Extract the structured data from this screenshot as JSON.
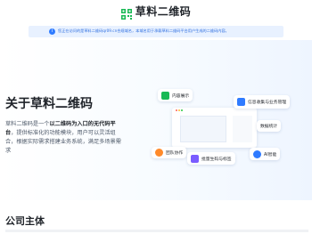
{
  "header": {
    "brand_text": "草料二维码",
    "logo_icon": "qr-logo-icon",
    "brand_color": "#19b955"
  },
  "notice": {
    "text": "您正在访问的是草料二维码qr09.cn合规域名，本域名用于承载草料二维码平台用户生成的二维码内容。",
    "accent": "#2f7bff"
  },
  "hero": {
    "title": "关于草料二维码",
    "desc_prefix": "草料二维码是一个",
    "desc_bold": "以二维码为入口的无代码平台",
    "desc_suffix": "，提供标准化的功能模块，用户可以灵活组合，根据实际需求搭建业务系统，满足多场景需求"
  },
  "diagram": {
    "features": [
      {
        "label": "内容展示",
        "icon": "content-icon",
        "color": "#19b955"
      },
      {
        "label": "信息收集与业务管理",
        "icon": "form-icon",
        "color": "#2f7bff"
      },
      {
        "label": "数据统计",
        "icon": "stats-icon",
        "color": "#2f7bff"
      },
      {
        "label": "团队协作",
        "icon": "team-icon",
        "color": "#ff8a2b"
      },
      {
        "label": "批量生码与标签",
        "icon": "batch-icon",
        "color": "#7a5cff"
      },
      {
        "label": "AI智能",
        "icon": "ai-icon",
        "color": "#2f7bff"
      }
    ]
  },
  "section": {
    "title": "公司主体"
  }
}
